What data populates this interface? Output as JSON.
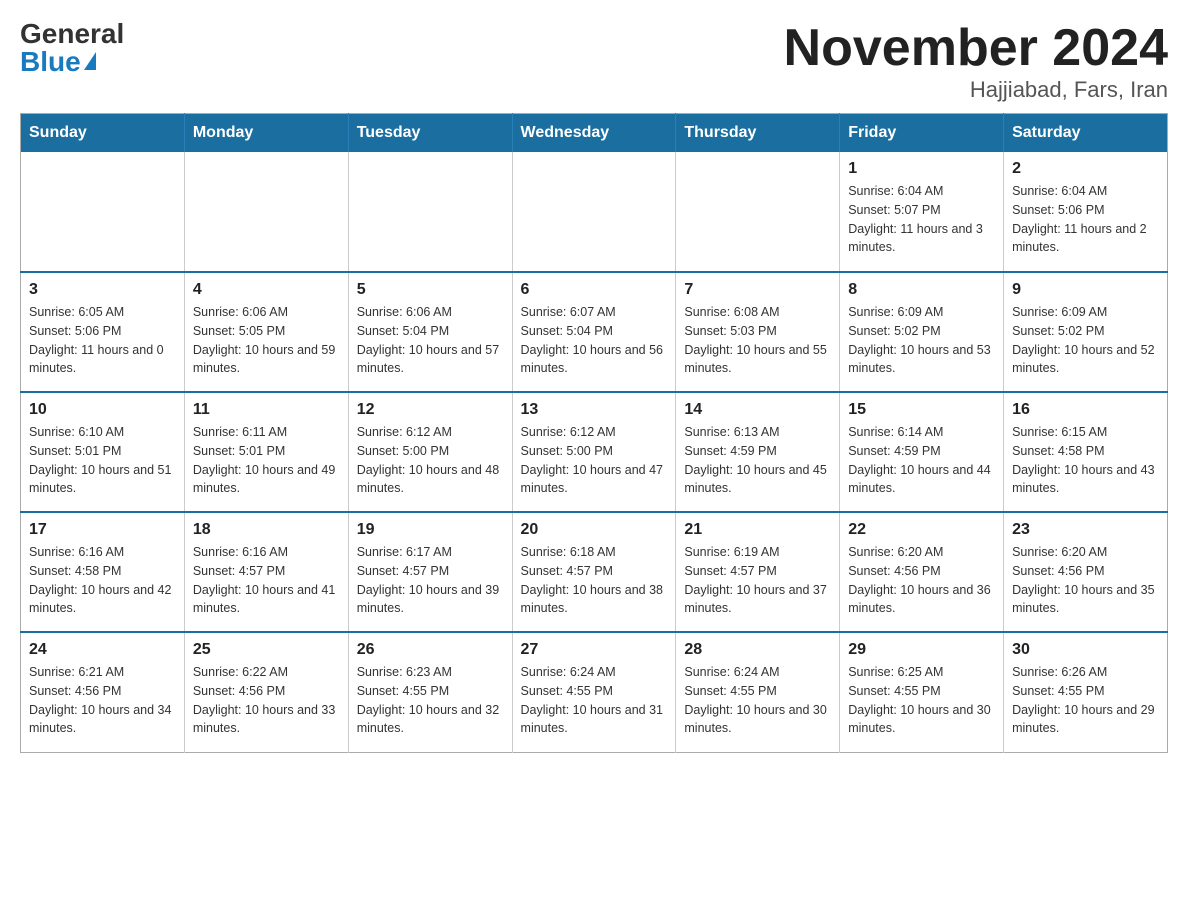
{
  "header": {
    "logo_general": "General",
    "logo_blue": "Blue",
    "title": "November 2024",
    "subtitle": "Hajjiabad, Fars, Iran"
  },
  "days_of_week": [
    "Sunday",
    "Monday",
    "Tuesday",
    "Wednesday",
    "Thursday",
    "Friday",
    "Saturday"
  ],
  "weeks": [
    [
      {
        "day": "",
        "info": ""
      },
      {
        "day": "",
        "info": ""
      },
      {
        "day": "",
        "info": ""
      },
      {
        "day": "",
        "info": ""
      },
      {
        "day": "",
        "info": ""
      },
      {
        "day": "1",
        "info": "Sunrise: 6:04 AM\nSunset: 5:07 PM\nDaylight: 11 hours and 3 minutes."
      },
      {
        "day": "2",
        "info": "Sunrise: 6:04 AM\nSunset: 5:06 PM\nDaylight: 11 hours and 2 minutes."
      }
    ],
    [
      {
        "day": "3",
        "info": "Sunrise: 6:05 AM\nSunset: 5:06 PM\nDaylight: 11 hours and 0 minutes."
      },
      {
        "day": "4",
        "info": "Sunrise: 6:06 AM\nSunset: 5:05 PM\nDaylight: 10 hours and 59 minutes."
      },
      {
        "day": "5",
        "info": "Sunrise: 6:06 AM\nSunset: 5:04 PM\nDaylight: 10 hours and 57 minutes."
      },
      {
        "day": "6",
        "info": "Sunrise: 6:07 AM\nSunset: 5:04 PM\nDaylight: 10 hours and 56 minutes."
      },
      {
        "day": "7",
        "info": "Sunrise: 6:08 AM\nSunset: 5:03 PM\nDaylight: 10 hours and 55 minutes."
      },
      {
        "day": "8",
        "info": "Sunrise: 6:09 AM\nSunset: 5:02 PM\nDaylight: 10 hours and 53 minutes."
      },
      {
        "day": "9",
        "info": "Sunrise: 6:09 AM\nSunset: 5:02 PM\nDaylight: 10 hours and 52 minutes."
      }
    ],
    [
      {
        "day": "10",
        "info": "Sunrise: 6:10 AM\nSunset: 5:01 PM\nDaylight: 10 hours and 51 minutes."
      },
      {
        "day": "11",
        "info": "Sunrise: 6:11 AM\nSunset: 5:01 PM\nDaylight: 10 hours and 49 minutes."
      },
      {
        "day": "12",
        "info": "Sunrise: 6:12 AM\nSunset: 5:00 PM\nDaylight: 10 hours and 48 minutes."
      },
      {
        "day": "13",
        "info": "Sunrise: 6:12 AM\nSunset: 5:00 PM\nDaylight: 10 hours and 47 minutes."
      },
      {
        "day": "14",
        "info": "Sunrise: 6:13 AM\nSunset: 4:59 PM\nDaylight: 10 hours and 45 minutes."
      },
      {
        "day": "15",
        "info": "Sunrise: 6:14 AM\nSunset: 4:59 PM\nDaylight: 10 hours and 44 minutes."
      },
      {
        "day": "16",
        "info": "Sunrise: 6:15 AM\nSunset: 4:58 PM\nDaylight: 10 hours and 43 minutes."
      }
    ],
    [
      {
        "day": "17",
        "info": "Sunrise: 6:16 AM\nSunset: 4:58 PM\nDaylight: 10 hours and 42 minutes."
      },
      {
        "day": "18",
        "info": "Sunrise: 6:16 AM\nSunset: 4:57 PM\nDaylight: 10 hours and 41 minutes."
      },
      {
        "day": "19",
        "info": "Sunrise: 6:17 AM\nSunset: 4:57 PM\nDaylight: 10 hours and 39 minutes."
      },
      {
        "day": "20",
        "info": "Sunrise: 6:18 AM\nSunset: 4:57 PM\nDaylight: 10 hours and 38 minutes."
      },
      {
        "day": "21",
        "info": "Sunrise: 6:19 AM\nSunset: 4:57 PM\nDaylight: 10 hours and 37 minutes."
      },
      {
        "day": "22",
        "info": "Sunrise: 6:20 AM\nSunset: 4:56 PM\nDaylight: 10 hours and 36 minutes."
      },
      {
        "day": "23",
        "info": "Sunrise: 6:20 AM\nSunset: 4:56 PM\nDaylight: 10 hours and 35 minutes."
      }
    ],
    [
      {
        "day": "24",
        "info": "Sunrise: 6:21 AM\nSunset: 4:56 PM\nDaylight: 10 hours and 34 minutes."
      },
      {
        "day": "25",
        "info": "Sunrise: 6:22 AM\nSunset: 4:56 PM\nDaylight: 10 hours and 33 minutes."
      },
      {
        "day": "26",
        "info": "Sunrise: 6:23 AM\nSunset: 4:55 PM\nDaylight: 10 hours and 32 minutes."
      },
      {
        "day": "27",
        "info": "Sunrise: 6:24 AM\nSunset: 4:55 PM\nDaylight: 10 hours and 31 minutes."
      },
      {
        "day": "28",
        "info": "Sunrise: 6:24 AM\nSunset: 4:55 PM\nDaylight: 10 hours and 30 minutes."
      },
      {
        "day": "29",
        "info": "Sunrise: 6:25 AM\nSunset: 4:55 PM\nDaylight: 10 hours and 30 minutes."
      },
      {
        "day": "30",
        "info": "Sunrise: 6:26 AM\nSunset: 4:55 PM\nDaylight: 10 hours and 29 minutes."
      }
    ]
  ]
}
